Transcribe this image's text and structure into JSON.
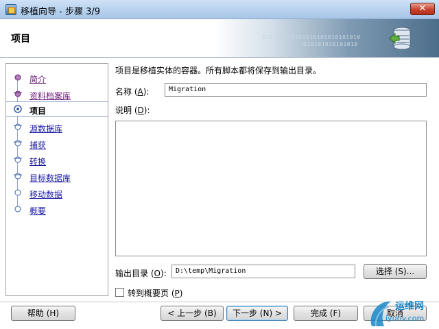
{
  "window": {
    "title": "移植向导 - 步骤 3/9",
    "close_glyph": "✕"
  },
  "header": {
    "title": "项目",
    "binary_text_1": "010101010101010101010101010",
    "binary_text_2": "010101010101010"
  },
  "nav": {
    "items": [
      {
        "label": "简介",
        "state": "visited"
      },
      {
        "label": "资料档案库",
        "state": "visited"
      },
      {
        "label": "项目",
        "state": "active"
      },
      {
        "label": "源数据库",
        "state": "link"
      },
      {
        "label": "捕获 ",
        "state": "link"
      },
      {
        "label": "转换",
        "state": "link"
      },
      {
        "label": "目标数据库",
        "state": "link"
      },
      {
        "label": "移动数据",
        "state": "link"
      },
      {
        "label": "概要",
        "state": "link"
      }
    ]
  },
  "main": {
    "description": "项目是移植实体的容器。所有脚本都将保存到输出目录。",
    "name_label": "名称",
    "name_key": "A",
    "name_value": "Migration",
    "notes_label": "说明",
    "notes_key": "D",
    "notes_value": "",
    "output_label": "输出目录",
    "output_key": "O",
    "output_value": "D:\\temp\\Migration",
    "choose_button": "选择 (S)...",
    "goto_summary_label": "转到概要页",
    "goto_summary_key": "P",
    "goto_summary_checked": false
  },
  "footer": {
    "help_button": "帮助 (H)",
    "back_button": "< 上一步 (B)",
    "next_button": "下一步 (N) >",
    "finish_button": "完成 (F)",
    "cancel_button": "取消"
  },
  "watermark": {
    "text": "运维网",
    "url": "iyunv.com"
  }
}
